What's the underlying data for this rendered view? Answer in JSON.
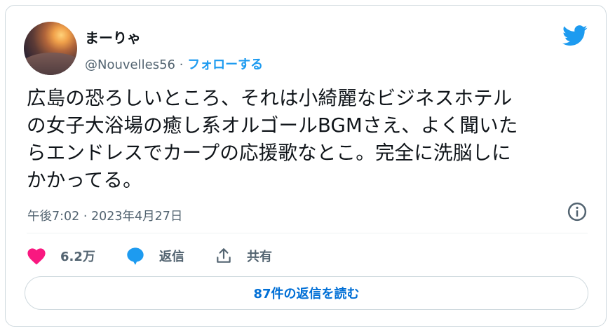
{
  "tweet": {
    "author": {
      "display_name": "まーりゃ",
      "handle": "@Nouvelles56",
      "separator": "·",
      "follow_label": "フォローする"
    },
    "text_lines": [
      "広島の恐ろしいところ、それは小綺麗なビジネスホテル",
      "の女子大浴場の癒し系オルゴールBGMさえ、よく聞いた",
      "らエンドレスでカープの応援歌なとこ。完全に洗脳しに",
      "かかってる。"
    ],
    "timestamp": "午後7:02 · 2023年4月27日",
    "actions": {
      "like_count": "6.2万",
      "reply_label": "返信",
      "share_label": "共有"
    },
    "replies_button": "87件の返信を読む"
  },
  "colors": {
    "accent": "#1d9bf0",
    "like": "#f91880",
    "text": "#0f1419",
    "muted": "#536471",
    "link": "#006fd6"
  },
  "icons": [
    "twitter-bird-icon",
    "info-icon",
    "heart-icon",
    "reply-bubble-icon",
    "share-icon"
  ]
}
